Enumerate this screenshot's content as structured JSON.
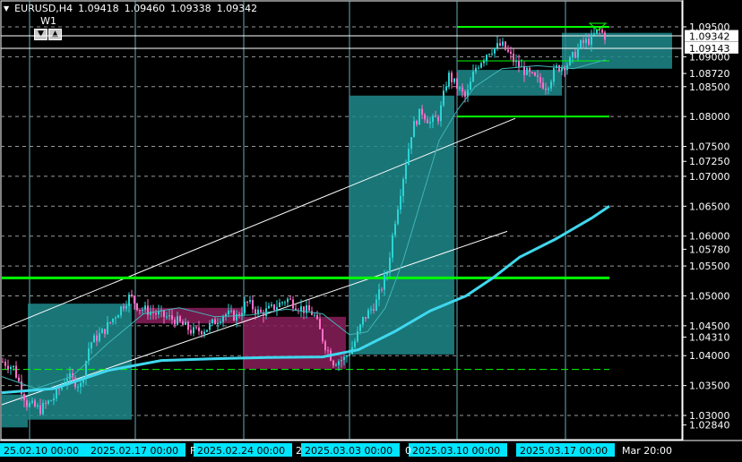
{
  "header": {
    "symbol": "EURUSD,H4",
    "open": "1.09418",
    "high": "1.09460",
    "low": "1.09338",
    "close": "1.09342",
    "timeframe_badge": "W1",
    "badge_down": "▼",
    "badge_up": "▲",
    "menu_icon": "triangle-down-icon"
  },
  "chart_data": {
    "type": "candlestick",
    "price_axis": {
      "ticks": [
        "1.09500",
        "1.09000",
        "1.08500",
        "1.08000",
        "1.07500",
        "1.07000",
        "1.06500",
        "1.06000",
        "1.05500",
        "1.05000",
        "1.04500",
        "1.04000",
        "1.03500",
        "1.03000"
      ],
      "extra_labels": [
        "1.07250",
        "1.05780",
        "1.04310",
        "1.02840",
        "1.08720"
      ],
      "price_flag": "1.09342",
      "line_flag": "1.09143",
      "range": [
        1.0265,
        1.0985
      ]
    },
    "time_axis": {
      "labels": [
        "25.02.10 00:00",
        "2025.02.17 00:00",
        "2025.02.24 00:00",
        "2025.03.03 00:00",
        "2025.03.10 00:00",
        "2025.03.17 00:00",
        "Mar 20:00"
      ],
      "stray": [
        "F",
        "2",
        "0"
      ]
    },
    "levels": [
      {
        "price": 1.095,
        "color": "#00ff00",
        "width": 2
      },
      {
        "price": 1.08,
        "color": "#00ff00",
        "width": 2
      },
      {
        "price": 1.053,
        "color": "#00ff00",
        "width": 3
      },
      {
        "price": 1.0377,
        "color": "#00ff00",
        "width": 1,
        "dashed": true
      },
      {
        "price": 1.0893,
        "color": "#00ff00",
        "width": 1
      },
      {
        "price": 1.0935,
        "color": "#ffffff",
        "width": 1
      },
      {
        "price": 1.0914,
        "color": "#ffffff",
        "width": 1
      }
    ],
    "colors": {
      "bull": "#2ad4d4",
      "bear": "#ff6ec8",
      "grid": "#9a9a9a",
      "teal_zone": "#1f8a8c",
      "maroon_zone": "#8a1f5a",
      "ma_slow": "#3fd8ee",
      "ma_fast": "#3fb6b6",
      "channel": "#ffffff",
      "axis_text": "#ffffff",
      "time_label_bg": "#00e5ff"
    }
  }
}
